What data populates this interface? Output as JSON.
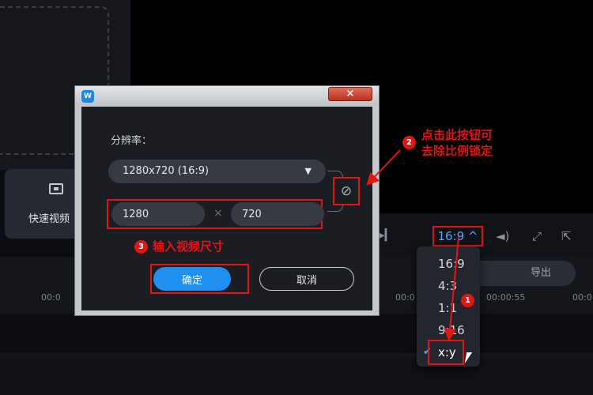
{
  "editor": {
    "quick_video_label": "快速视频",
    "aspect_ratio": "16:9 ^",
    "export_label": "导出",
    "timeline_ticks": [
      "00:0",
      "00:0",
      "00:00:55",
      "00:0"
    ],
    "ratio_options": [
      "16:9",
      "4:3",
      "1:1",
      "9:16",
      "x:y"
    ],
    "selected_ratio": "x:y"
  },
  "dialog": {
    "close_glyph": "×",
    "resolution_label": "分辨率：",
    "resolution_value": "1280x720 (16:9)",
    "width_value": "1280",
    "height_value": "720",
    "times_glyph": "×",
    "confirm_label": "确定",
    "cancel_label": "取消"
  },
  "annotations": {
    "step1_number": "1",
    "step2_number": "2",
    "step2_text_line1": "点击此按钮可",
    "step2_text_line2": "去除比例锁定",
    "step3_number": "3",
    "step3_text": "输入视频尺寸",
    "accent_color": "#e01515"
  },
  "colors": {
    "brand_blue": "#1f8ff0",
    "link_blue": "#4ea6ff"
  },
  "icons": {
    "unlink": "unlink-icon",
    "play": "play-icon",
    "volume": "volume-icon",
    "fullscreen": "fullscreen-icon",
    "popout": "popout-icon",
    "check": "check-icon",
    "cursor": "cursor-icon"
  }
}
